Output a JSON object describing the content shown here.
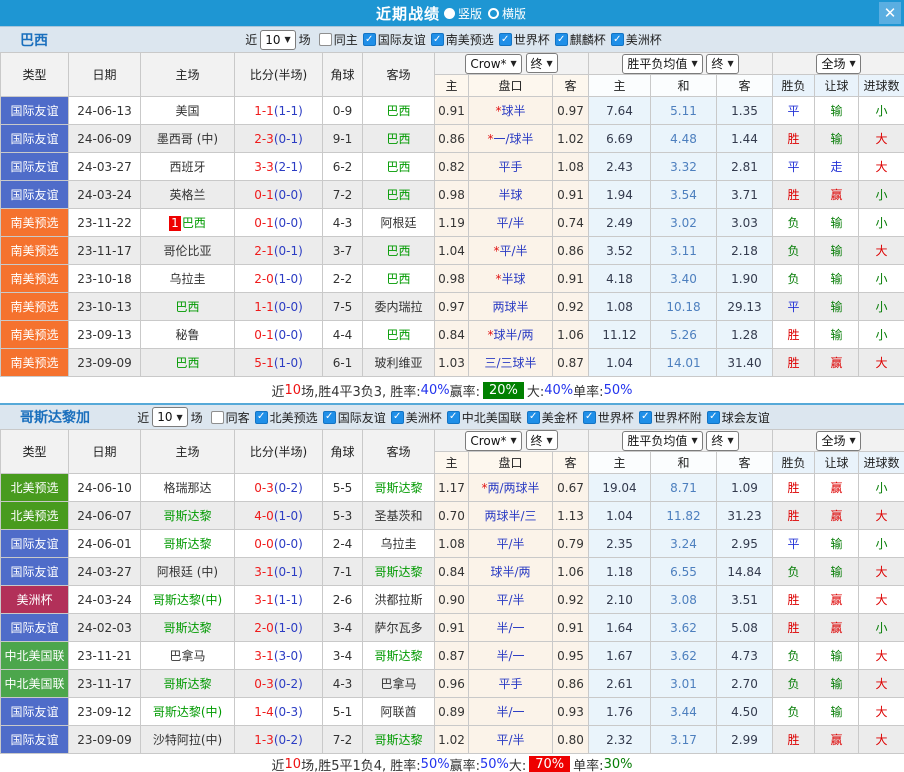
{
  "titlebar": {
    "title": "近期战绩",
    "radio_vertical": "竖版",
    "radio_horizontal": "横版"
  },
  "icons": {
    "close": "✕",
    "check": "✓",
    "arrow": "▼"
  },
  "columns": {
    "type": "类型",
    "date": "日期",
    "home": "主场",
    "score": "比分(半场)",
    "corner": "角球",
    "away": "客场",
    "company": "Crow*",
    "final": "终",
    "odds_sub": [
      "主",
      "盘口",
      "客"
    ],
    "avg": "胜平负均值",
    "avg_sub": [
      "主",
      "和",
      "客"
    ],
    "scope": "全场",
    "res_sub": [
      "胜负",
      "让球",
      "进球数"
    ]
  },
  "type_colors": {
    "国际友谊": "#4f6cc9",
    "南美预选": "#f5722e",
    "北美预选": "#489b1e",
    "美洲杯": "#b23059",
    "中北美国联": "#4ca64c"
  },
  "status_colors": {
    "胜": "#dd0000",
    "平": "#2433d6",
    "负": "#067d06",
    "赢": "#dd0000",
    "走": "#2433d6",
    "输": "#067d06",
    "大": "#dd0000",
    "小": "#067d06"
  },
  "sections": [
    {
      "team": "巴西",
      "filter": {
        "near_label": "近",
        "count": "10",
        "games_label": "场",
        "same": {
          "label": "同主",
          "checked": false
        },
        "competitions": [
          {
            "label": "国际友谊",
            "checked": true
          },
          {
            "label": "南美预选",
            "checked": true
          },
          {
            "label": "世界杯",
            "checked": true
          },
          {
            "label": "麒麟杯",
            "checked": true
          },
          {
            "label": "美洲杯",
            "checked": true
          }
        ]
      },
      "rows": [
        {
          "type": "国际友谊",
          "date": "24-06-13",
          "home": "美国",
          "homeGreen": false,
          "badge": "",
          "score": "1-1",
          "half": "(1-1)",
          "corner": "0-9",
          "away": "巴西",
          "awayGreen": true,
          "o1": "0.91",
          "star": true,
          "handicap": "球半",
          "o2": "0.97",
          "a1": "7.64",
          "a2": "5.11",
          "a3": "1.35",
          "r1": "平",
          "r2": "输",
          "r3": "小"
        },
        {
          "type": "国际友谊",
          "date": "24-06-09",
          "home": "墨西哥 (中)",
          "homeGreen": false,
          "badge": "",
          "score": "2-3",
          "half": "(0-1)",
          "corner": "9-1",
          "away": "巴西",
          "awayGreen": true,
          "o1": "0.86",
          "star": true,
          "handicap": "一/球半",
          "o2": "1.02",
          "a1": "6.69",
          "a2": "4.48",
          "a3": "1.44",
          "r1": "胜",
          "r2": "输",
          "r3": "大"
        },
        {
          "type": "国际友谊",
          "date": "24-03-27",
          "home": "西班牙",
          "homeGreen": false,
          "badge": "",
          "score": "3-3",
          "half": "(2-1)",
          "corner": "6-2",
          "away": "巴西",
          "awayGreen": true,
          "o1": "0.82",
          "star": false,
          "handicap": "平手",
          "o2": "1.08",
          "a1": "2.43",
          "a2": "3.32",
          "a3": "2.81",
          "r1": "平",
          "r2": "走",
          "r3": "大"
        },
        {
          "type": "国际友谊",
          "date": "24-03-24",
          "home": "英格兰",
          "homeGreen": false,
          "badge": "",
          "score": "0-1",
          "half": "(0-0)",
          "corner": "7-2",
          "away": "巴西",
          "awayGreen": true,
          "o1": "0.98",
          "star": false,
          "handicap": "半球",
          "o2": "0.91",
          "a1": "1.94",
          "a2": "3.54",
          "a3": "3.71",
          "r1": "胜",
          "r2": "赢",
          "r3": "小"
        },
        {
          "type": "南美预选",
          "date": "23-11-22",
          "home": "巴西",
          "homeGreen": true,
          "badge": "1",
          "score": "0-1",
          "half": "(0-0)",
          "corner": "4-3",
          "away": "阿根廷",
          "awayGreen": false,
          "o1": "1.19",
          "star": false,
          "handicap": "平/半",
          "o2": "0.74",
          "a1": "2.49",
          "a2": "3.02",
          "a3": "3.03",
          "r1": "负",
          "r2": "输",
          "r3": "小"
        },
        {
          "type": "南美预选",
          "date": "23-11-17",
          "home": "哥伦比亚",
          "homeGreen": false,
          "badge": "",
          "score": "2-1",
          "half": "(0-1)",
          "corner": "3-7",
          "away": "巴西",
          "awayGreen": true,
          "o1": "1.04",
          "star": true,
          "handicap": "平/半",
          "o2": "0.86",
          "a1": "3.52",
          "a2": "3.11",
          "a3": "2.18",
          "r1": "负",
          "r2": "输",
          "r3": "大"
        },
        {
          "type": "南美预选",
          "date": "23-10-18",
          "home": "乌拉圭",
          "homeGreen": false,
          "badge": "",
          "score": "2-0",
          "half": "(1-0)",
          "corner": "2-2",
          "away": "巴西",
          "awayGreen": true,
          "o1": "0.98",
          "star": true,
          "handicap": "半球",
          "o2": "0.91",
          "a1": "4.18",
          "a2": "3.40",
          "a3": "1.90",
          "r1": "负",
          "r2": "输",
          "r3": "小"
        },
        {
          "type": "南美预选",
          "date": "23-10-13",
          "home": "巴西",
          "homeGreen": true,
          "badge": "",
          "score": "1-1",
          "half": "(0-0)",
          "corner": "7-5",
          "away": "委内瑞拉",
          "awayGreen": false,
          "o1": "0.97",
          "star": false,
          "handicap": "两球半",
          "o2": "0.92",
          "a1": "1.08",
          "a2": "10.18",
          "a3": "29.13",
          "r1": "平",
          "r2": "输",
          "r3": "小"
        },
        {
          "type": "南美预选",
          "date": "23-09-13",
          "home": "秘鲁",
          "homeGreen": false,
          "badge": "",
          "score": "0-1",
          "half": "(0-0)",
          "corner": "4-4",
          "away": "巴西",
          "awayGreen": true,
          "o1": "0.84",
          "star": true,
          "handicap": "球半/两",
          "o2": "1.06",
          "a1": "11.12",
          "a2": "5.26",
          "a3": "1.28",
          "r1": "胜",
          "r2": "输",
          "r3": "小"
        },
        {
          "type": "南美预选",
          "date": "23-09-09",
          "home": "巴西",
          "homeGreen": true,
          "badge": "",
          "score": "5-1",
          "half": "(1-0)",
          "corner": "6-1",
          "away": "玻利维亚",
          "awayGreen": false,
          "o1": "1.03",
          "star": false,
          "handicap": "三/三球半",
          "o2": "0.87",
          "a1": "1.04",
          "a2": "14.01",
          "a3": "31.40",
          "r1": "胜",
          "r2": "赢",
          "r3": "大"
        }
      ],
      "summary": [
        {
          "t": "近",
          "c": "#333"
        },
        {
          "t": "10",
          "c": "#ee1111"
        },
        {
          "t": "场,胜4平3负3, 胜率:",
          "c": "#333"
        },
        {
          "t": "40%",
          "c": "#2233ee"
        },
        {
          "t": " 赢率: ",
          "c": "#333"
        },
        {
          "t": "20%",
          "c": "#ffffff",
          "bg": "#008000"
        },
        {
          "t": " 大:",
          "c": "#333"
        },
        {
          "t": "40%",
          "c": "#2233ee"
        },
        {
          "t": " 单率:",
          "c": "#333"
        },
        {
          "t": "50%",
          "c": "#2233ee"
        }
      ]
    },
    {
      "team": "哥斯达黎加",
      "filter": {
        "near_label": "近",
        "count": "10",
        "games_label": "场",
        "same": {
          "label": "同客",
          "checked": false
        },
        "competitions": [
          {
            "label": "北美预选",
            "checked": true
          },
          {
            "label": "国际友谊",
            "checked": true
          },
          {
            "label": "美洲杯",
            "checked": true
          },
          {
            "label": "中北美国联",
            "checked": true
          },
          {
            "label": "美金杯",
            "checked": true
          },
          {
            "label": "世界杯",
            "checked": true
          },
          {
            "label": "世界杯附",
            "checked": true
          },
          {
            "label": "球会友谊",
            "checked": true
          }
        ]
      },
      "rows": [
        {
          "type": "北美预选",
          "date": "24-06-10",
          "home": "格瑞那达",
          "homeGreen": false,
          "badge": "",
          "score": "0-3",
          "half": "(0-2)",
          "corner": "5-5",
          "away": "哥斯达黎",
          "awayGreen": true,
          "o1": "1.17",
          "star": true,
          "handicap": "两/两球半",
          "o2": "0.67",
          "a1": "19.04",
          "a2": "8.71",
          "a3": "1.09",
          "r1": "胜",
          "r2": "赢",
          "r3": "小"
        },
        {
          "type": "北美预选",
          "date": "24-06-07",
          "home": "哥斯达黎",
          "homeGreen": true,
          "badge": "",
          "score": "4-0",
          "half": "(1-0)",
          "corner": "5-3",
          "away": "圣基茨和",
          "awayGreen": false,
          "o1": "0.70",
          "star": false,
          "handicap": "两球半/三",
          "o2": "1.13",
          "a1": "1.04",
          "a2": "11.82",
          "a3": "31.23",
          "r1": "胜",
          "r2": "赢",
          "r3": "大"
        },
        {
          "type": "国际友谊",
          "date": "24-06-01",
          "home": "哥斯达黎",
          "homeGreen": true,
          "badge": "",
          "score": "0-0",
          "half": "(0-0)",
          "corner": "2-4",
          "away": "乌拉圭",
          "awayGreen": false,
          "o1": "1.08",
          "star": false,
          "handicap": "平/半",
          "o2": "0.79",
          "a1": "2.35",
          "a2": "3.24",
          "a3": "2.95",
          "r1": "平",
          "r2": "输",
          "r3": "小"
        },
        {
          "type": "国际友谊",
          "date": "24-03-27",
          "home": "阿根廷 (中)",
          "homeGreen": false,
          "badge": "",
          "score": "3-1",
          "half": "(0-1)",
          "corner": "7-1",
          "away": "哥斯达黎",
          "awayGreen": true,
          "o1": "0.84",
          "star": false,
          "handicap": "球半/两",
          "o2": "1.06",
          "a1": "1.18",
          "a2": "6.55",
          "a3": "14.84",
          "r1": "负",
          "r2": "输",
          "r3": "大"
        },
        {
          "type": "美洲杯",
          "date": "24-03-24",
          "home": "哥斯达黎(中)",
          "homeGreen": true,
          "badge": "",
          "score": "3-1",
          "half": "(1-1)",
          "corner": "2-6",
          "away": "洪都拉斯",
          "awayGreen": false,
          "o1": "0.90",
          "star": false,
          "handicap": "平/半",
          "o2": "0.92",
          "a1": "2.10",
          "a2": "3.08",
          "a3": "3.51",
          "r1": "胜",
          "r2": "赢",
          "r3": "大"
        },
        {
          "type": "国际友谊",
          "date": "24-02-03",
          "home": "哥斯达黎",
          "homeGreen": true,
          "badge": "",
          "score": "2-0",
          "half": "(1-0)",
          "corner": "3-4",
          "away": "萨尔瓦多",
          "awayGreen": false,
          "o1": "0.91",
          "star": false,
          "handicap": "半/一",
          "o2": "0.91",
          "a1": "1.64",
          "a2": "3.62",
          "a3": "5.08",
          "r1": "胜",
          "r2": "赢",
          "r3": "小"
        },
        {
          "type": "中北美国联",
          "date": "23-11-21",
          "home": "巴拿马",
          "homeGreen": false,
          "badge": "",
          "score": "3-1",
          "half": "(3-0)",
          "corner": "3-4",
          "away": "哥斯达黎",
          "awayGreen": true,
          "o1": "0.87",
          "star": false,
          "handicap": "半/一",
          "o2": "0.95",
          "a1": "1.67",
          "a2": "3.62",
          "a3": "4.73",
          "r1": "负",
          "r2": "输",
          "r3": "大"
        },
        {
          "type": "中北美国联",
          "date": "23-11-17",
          "home": "哥斯达黎",
          "homeGreen": true,
          "badge": "",
          "score": "0-3",
          "half": "(0-2)",
          "corner": "4-3",
          "away": "巴拿马",
          "awayGreen": false,
          "o1": "0.96",
          "star": false,
          "handicap": "平手",
          "o2": "0.86",
          "a1": "2.61",
          "a2": "3.01",
          "a3": "2.70",
          "r1": "负",
          "r2": "输",
          "r3": "大"
        },
        {
          "type": "国际友谊",
          "date": "23-09-12",
          "home": "哥斯达黎(中)",
          "homeGreen": true,
          "badge": "",
          "score": "1-4",
          "half": "(0-3)",
          "corner": "5-1",
          "away": "阿联酋",
          "awayGreen": false,
          "o1": "0.89",
          "star": false,
          "handicap": "半/一",
          "o2": "0.93",
          "a1": "1.76",
          "a2": "3.44",
          "a3": "4.50",
          "r1": "负",
          "r2": "输",
          "r3": "大"
        },
        {
          "type": "国际友谊",
          "date": "23-09-09",
          "home": "沙特阿拉(中)",
          "homeGreen": false,
          "badge": "",
          "score": "1-3",
          "half": "(0-2)",
          "corner": "7-2",
          "away": "哥斯达黎",
          "awayGreen": true,
          "o1": "1.02",
          "star": false,
          "handicap": "平/半",
          "o2": "0.80",
          "a1": "2.32",
          "a2": "3.17",
          "a3": "2.99",
          "r1": "胜",
          "r2": "赢",
          "r3": "大"
        }
      ],
      "summary": [
        {
          "t": "近",
          "c": "#333"
        },
        {
          "t": "10",
          "c": "#ee1111"
        },
        {
          "t": "场,胜5平1负4, 胜率:",
          "c": "#333"
        },
        {
          "t": "50%",
          "c": "#2233ee"
        },
        {
          "t": " 赢率:",
          "c": "#333"
        },
        {
          "t": "50%",
          "c": "#2233ee"
        },
        {
          "t": " 大: ",
          "c": "#333"
        },
        {
          "t": "70%",
          "c": "#ffffff",
          "bg": "#ee0000"
        },
        {
          "t": " 单率:",
          "c": "#333"
        },
        {
          "t": "30%",
          "c": "#067d06"
        }
      ]
    }
  ]
}
